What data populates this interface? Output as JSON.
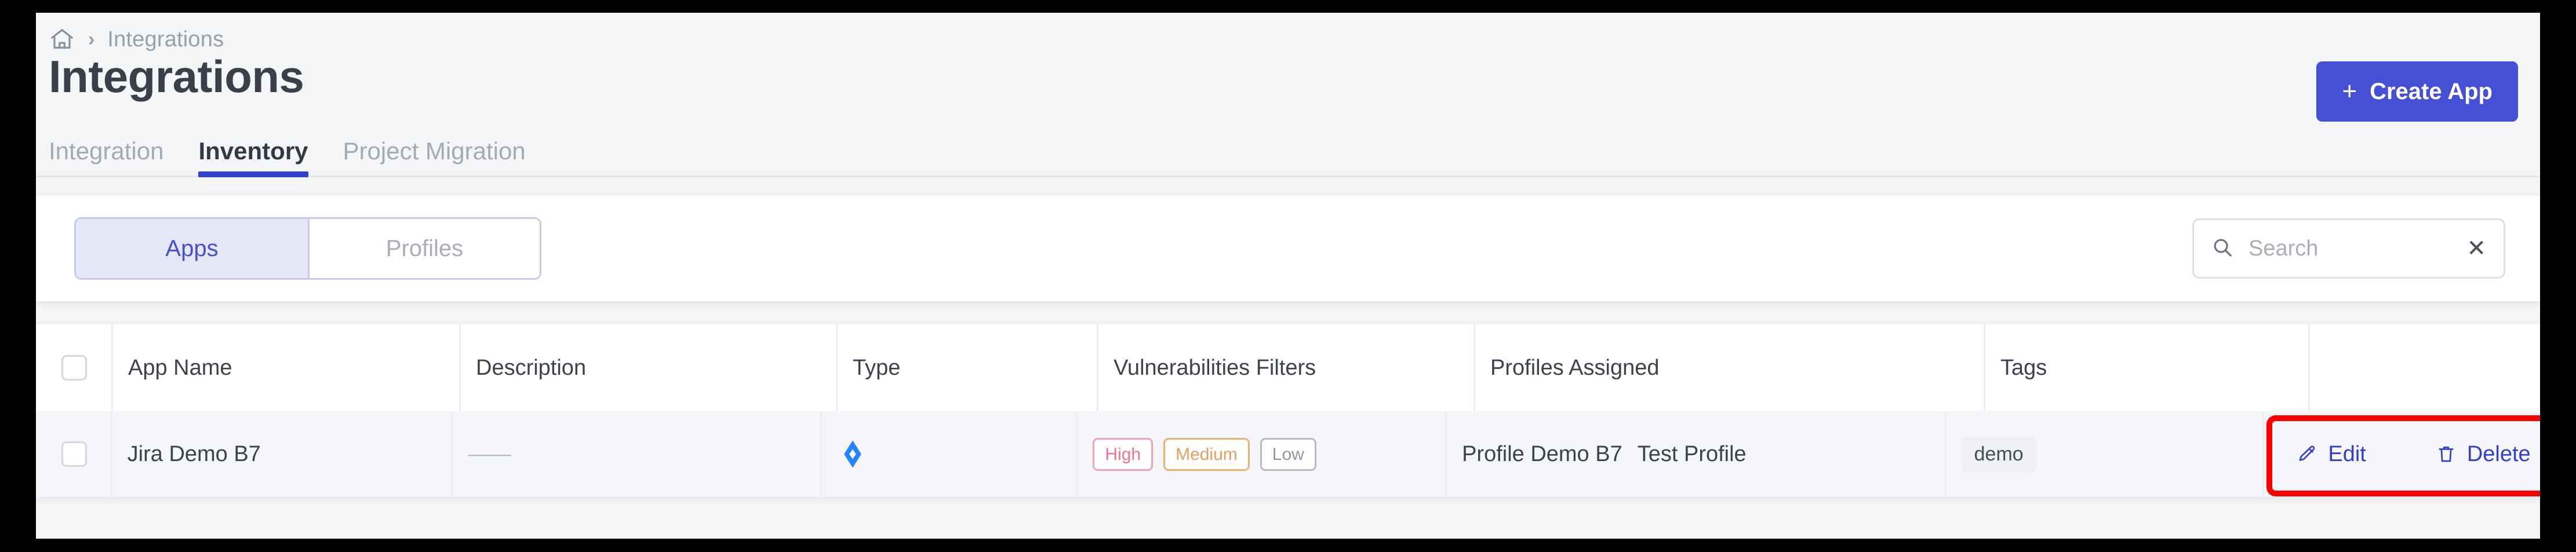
{
  "breadcrumb": {
    "home_icon": "home-icon",
    "separator": "›",
    "current": "Integrations"
  },
  "header": {
    "title": "Integrations",
    "create_button": {
      "plus": "+",
      "label": "Create App"
    },
    "accent_color": "#4550d4"
  },
  "tabs": [
    {
      "label": "Integration",
      "active": false
    },
    {
      "label": "Inventory",
      "active": true
    },
    {
      "label": "Project Migration",
      "active": false
    }
  ],
  "toolbar": {
    "segments": [
      {
        "label": "Apps",
        "active": true
      },
      {
        "label": "Profiles",
        "active": false
      }
    ],
    "search": {
      "icon": "search-icon",
      "placeholder": "Search",
      "value": "",
      "clear_label": "✕"
    }
  },
  "table": {
    "columns": [
      {
        "key": "select",
        "label": ""
      },
      {
        "key": "app_name",
        "label": "App Name"
      },
      {
        "key": "description",
        "label": "Description"
      },
      {
        "key": "type",
        "label": "Type"
      },
      {
        "key": "vulnerabilities",
        "label": "Vulnerabilities Filters"
      },
      {
        "key": "profiles",
        "label": "Profiles Assigned"
      },
      {
        "key": "tags",
        "label": "Tags"
      },
      {
        "key": "actions",
        "label": ""
      }
    ],
    "rows": [
      {
        "app_name": "Jira Demo B7",
        "description": "——",
        "type_icon": "jira-icon",
        "vulnerabilities": [
          {
            "label": "High",
            "level": "high"
          },
          {
            "label": "Medium",
            "level": "medium"
          },
          {
            "label": "Low",
            "level": "low"
          }
        ],
        "profiles": [
          "Profile Demo B7",
          "Test Profile"
        ],
        "tags": [
          "demo"
        ],
        "actions": [
          {
            "label": "Edit",
            "icon": "pencil-icon"
          },
          {
            "label": "Delete",
            "icon": "trash-icon"
          }
        ]
      }
    ]
  },
  "annotation": {
    "highlight_color": "#fb0000"
  }
}
